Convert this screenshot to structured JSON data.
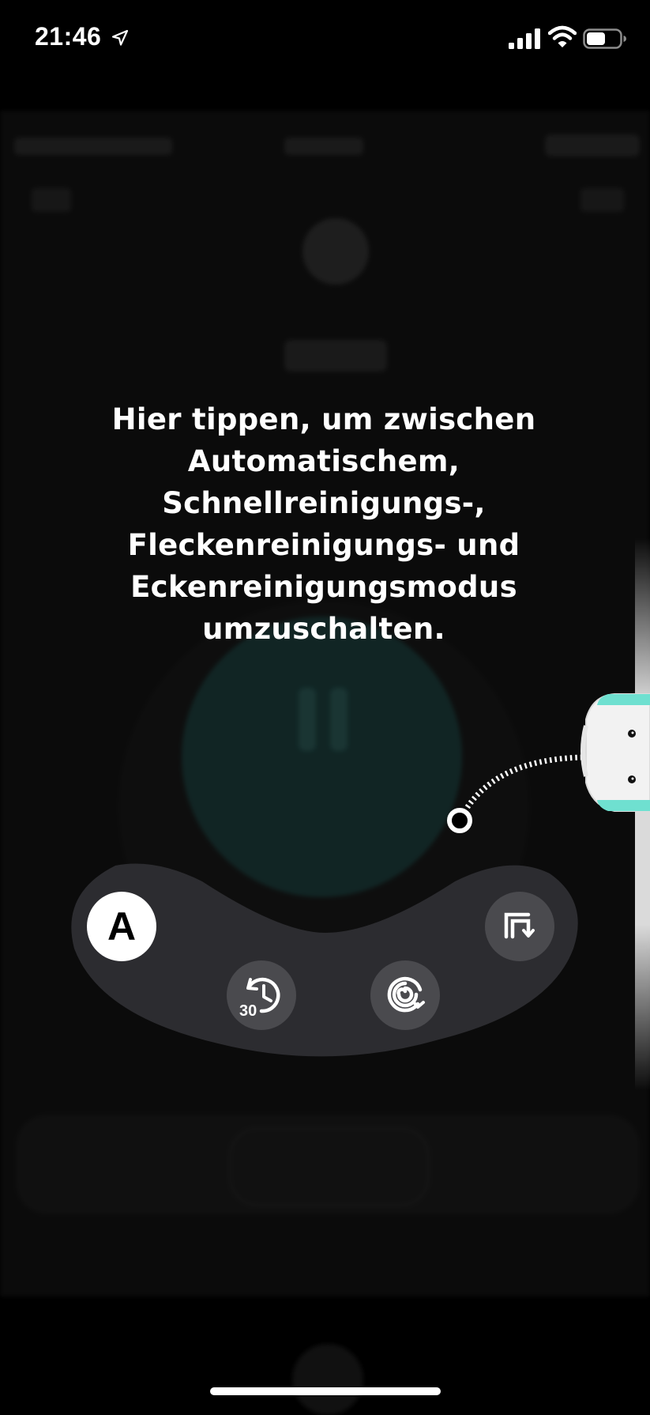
{
  "status_bar": {
    "time": "21:46",
    "icons": [
      "location-arrow-icon",
      "cellular-signal-icon",
      "wifi-icon",
      "battery-icon"
    ]
  },
  "overlay": {
    "instruction": "Hier tippen, um zwischen Automatischem, Schnellreinigungs-, Fleckenreinigungs- und Eckenreinigungsmodus umzuschalten."
  },
  "mode_selector": {
    "modes": [
      {
        "name": "auto",
        "label": "A",
        "icon": "auto-mode-icon",
        "selected": true
      },
      {
        "name": "quick-clean",
        "label": "30",
        "icon": "quick-clean-30-icon",
        "selected": false
      },
      {
        "name": "spot-clean",
        "icon": "spiral-spot-icon",
        "selected": false
      },
      {
        "name": "edge-clean",
        "icon": "edge-corner-icon",
        "selected": false
      }
    ]
  },
  "colors": {
    "background": "#000000",
    "panel": "#2c2c30",
    "mode_button": "#4a4a4e",
    "selected_mode": "#ffffff",
    "accent_teal": "#6fe0d0"
  }
}
